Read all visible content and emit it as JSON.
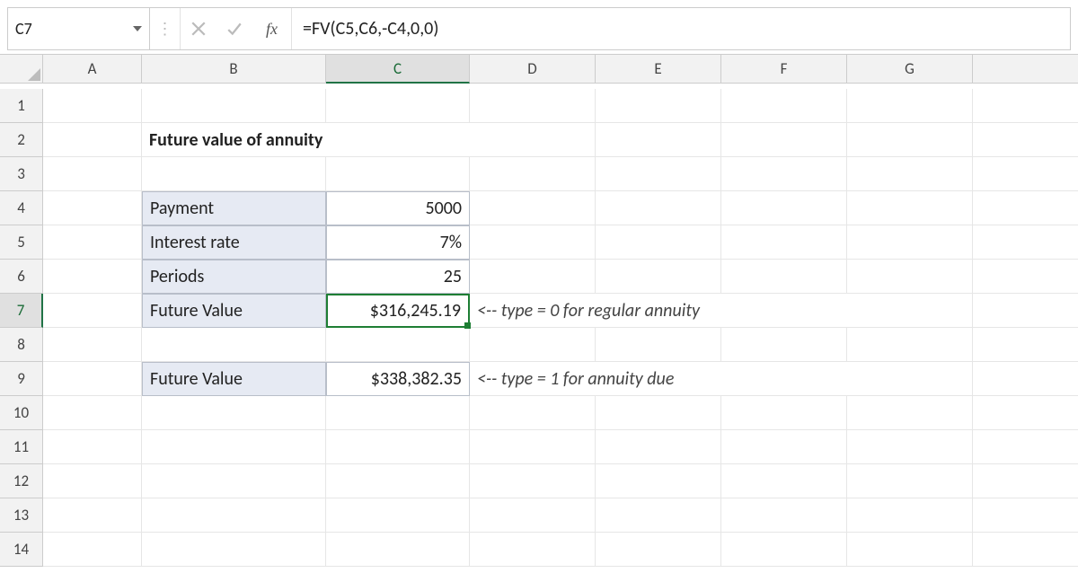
{
  "namebox": {
    "value": "C7"
  },
  "fx_label": "fx",
  "formula": "=FV(C5,C6,-C4,0,0)",
  "columns": [
    "A",
    "B",
    "C",
    "D",
    "E",
    "F",
    "G"
  ],
  "rows": [
    "1",
    "2",
    "3",
    "4",
    "5",
    "6",
    "7",
    "8",
    "9",
    "10",
    "11",
    "12",
    "13",
    "14"
  ],
  "selected": {
    "row": "7",
    "col": "C"
  },
  "content": {
    "title": "Future value of annuity",
    "labels": {
      "payment": "Payment",
      "interest_rate": "Interest rate",
      "periods": "Periods",
      "future_value_a": "Future Value",
      "future_value_b": "Future Value"
    },
    "values": {
      "payment": "5000",
      "interest_rate": "7%",
      "periods": "25",
      "future_value_a": "$316,245.19",
      "future_value_b": "$338,382.35"
    },
    "notes": {
      "a": "<-- type = 0 for regular annuity",
      "b": "<-- type = 1 for annuity due"
    }
  }
}
